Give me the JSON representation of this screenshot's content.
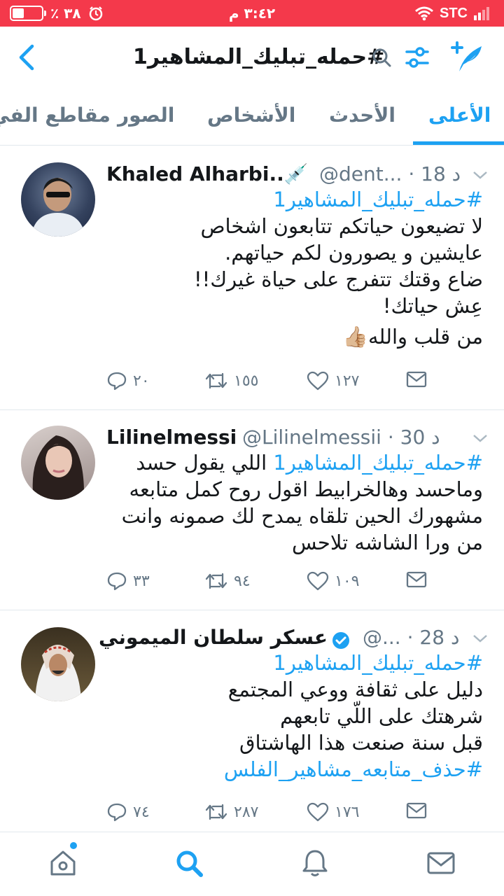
{
  "status_bar": {
    "battery_percent_text": "٣٨ ٪",
    "battery_level": 0.38,
    "time": "٣:٤٢ م",
    "carrier": "STC"
  },
  "header": {
    "search_term": "#حمله_تبليك_المشاهير1"
  },
  "tabs": [
    {
      "label": "الأعلى",
      "active": true
    },
    {
      "label": "الأحدث",
      "active": false
    },
    {
      "label": "الأشخاص",
      "active": false
    },
    {
      "label": "الصور",
      "active": false
    },
    {
      "label": "مقاطع الفي",
      "active": false
    }
  ],
  "tweets": [
    {
      "name": "Khaled Alharbi..💉",
      "handle": "@dent...",
      "time": "18 د",
      "lines": [
        {
          "text": "#حمله_تبليك_المشاهير1",
          "hashtag": true
        },
        {
          "text": "لا تضيعون حياتكم تتابعون اشخاص",
          "hashtag": false
        },
        {
          "text": "عايشين و يصورون لكم حياتهم.",
          "hashtag": false
        },
        {
          "text": "ضاع وقتك تتفرج على حياة غيرك!!",
          "hashtag": false
        },
        {
          "text": "عِش حياتك!",
          "hashtag": false
        },
        {
          "text": "من قلب والله👍🏼",
          "hashtag": false
        }
      ],
      "replies": "٢٠",
      "retweets": "١٥٥",
      "likes": "١٢٧"
    },
    {
      "name": "Lilinelmessi",
      "handle": "@Lilinelmessii",
      "time": "30 د",
      "lines": [
        {
          "text": "#حمله_تبليك_المشاهير1 اللي يقول حسد",
          "hashtag": "partial",
          "tag": "#حمله_تبليك_المشاهير1",
          "rest": " اللي يقول حسد"
        },
        {
          "text": "وماحسد وهالخرابيط اقول روح كمل متابعه",
          "hashtag": false
        },
        {
          "text": "مشهورك الحين تلقاه يمدح لك صمونه وانت",
          "hashtag": false
        },
        {
          "text": "من ورا الشاشه تلاحس",
          "hashtag": false
        }
      ],
      "replies": "٣٣",
      "retweets": "٩٤",
      "likes": "١٠٩"
    },
    {
      "name": "عسكر سلطان الميموني",
      "handle": "@...",
      "time": "28 د",
      "verified": true,
      "lines": [
        {
          "text": "#حمله_تبليك_المشاهير1",
          "hashtag": true
        },
        {
          "text": "دليل على ثقافة ووعي المجتمع",
          "hashtag": false
        },
        {
          "text": "شرهتك على اللّي تابعهم",
          "hashtag": false
        },
        {
          "text": "قبل سنة صنعت هذا الهاشتاق",
          "hashtag": false
        },
        {
          "text": "#حذف_متابعه_مشاهير_الفلس",
          "hashtag": true
        }
      ],
      "replies": "٧٤",
      "retweets": "٢٨٧",
      "likes": "١٧٦"
    }
  ],
  "colors": {
    "status_bar": "#f4394b",
    "accent": "#1da1f2",
    "secondary_text": "#657786",
    "primary_text": "#14171a"
  },
  "icons": [
    "back-icon",
    "search-icon",
    "filter-icon",
    "compose-icon",
    "reply-icon",
    "retweet-icon",
    "like-icon",
    "dm-icon",
    "home-icon",
    "explore-icon",
    "notifications-icon",
    "messages-icon"
  ]
}
